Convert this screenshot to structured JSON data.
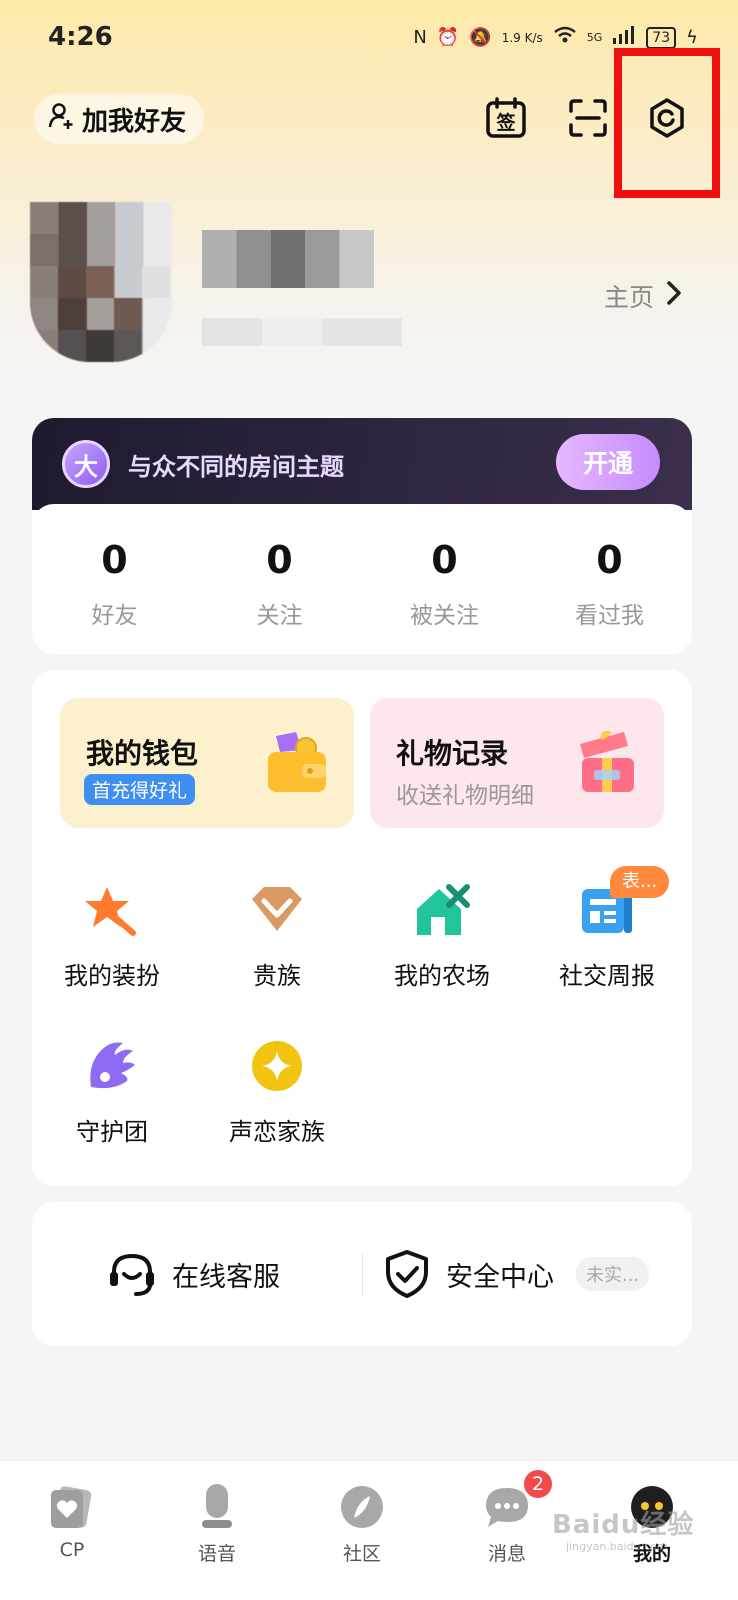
{
  "status_bar": {
    "time": "4:26",
    "speed": "1.9 K/s",
    "signal": "5G",
    "battery": "73"
  },
  "header": {
    "add_friend_label": "加我好友",
    "sign_in_label": "签",
    "scan_icon": "scan-icon",
    "settings_icon": "settings-hex-icon"
  },
  "profile": {
    "homepage_label": "主页"
  },
  "vip_banner": {
    "badge": "大",
    "text": "与众不同的房间主题",
    "button": "开通"
  },
  "stats": [
    {
      "value": "0",
      "label": "好友"
    },
    {
      "value": "0",
      "label": "关注"
    },
    {
      "value": "0",
      "label": "被关注"
    },
    {
      "value": "0",
      "label": "看过我"
    }
  ],
  "tiles": {
    "wallet": {
      "title": "我的钱包",
      "tag": "首充得好礼"
    },
    "gifts": {
      "title": "礼物记录",
      "subtitle": "收送礼物明细"
    }
  },
  "grid": [
    {
      "label": "我的装扮",
      "icon": "star-brush-icon",
      "color": "#ff7a2d"
    },
    {
      "label": "贵族",
      "icon": "diamond-icon",
      "color": "#d99a63"
    },
    {
      "label": "我的农场",
      "icon": "farm-house-icon",
      "color": "#22c49b"
    },
    {
      "label": "社交周报",
      "icon": "report-icon",
      "color": "#3aa0f0",
      "badge": "表..."
    },
    {
      "label": "守护团",
      "icon": "wing-icon",
      "color": "#8d6cf2"
    },
    {
      "label": "声恋家族",
      "icon": "sparkle-circle-icon",
      "color": "#f1c40f"
    }
  ],
  "services": {
    "support": "在线客服",
    "security": "安全中心",
    "security_tag": "未实..."
  },
  "tabs": [
    {
      "label": "CP"
    },
    {
      "label": "语音"
    },
    {
      "label": "社区"
    },
    {
      "label": "消息",
      "badge": "2"
    },
    {
      "label": "我的"
    }
  ],
  "watermark": {
    "text": "Baidu经验",
    "sub": "jingyan.baidu.com"
  }
}
